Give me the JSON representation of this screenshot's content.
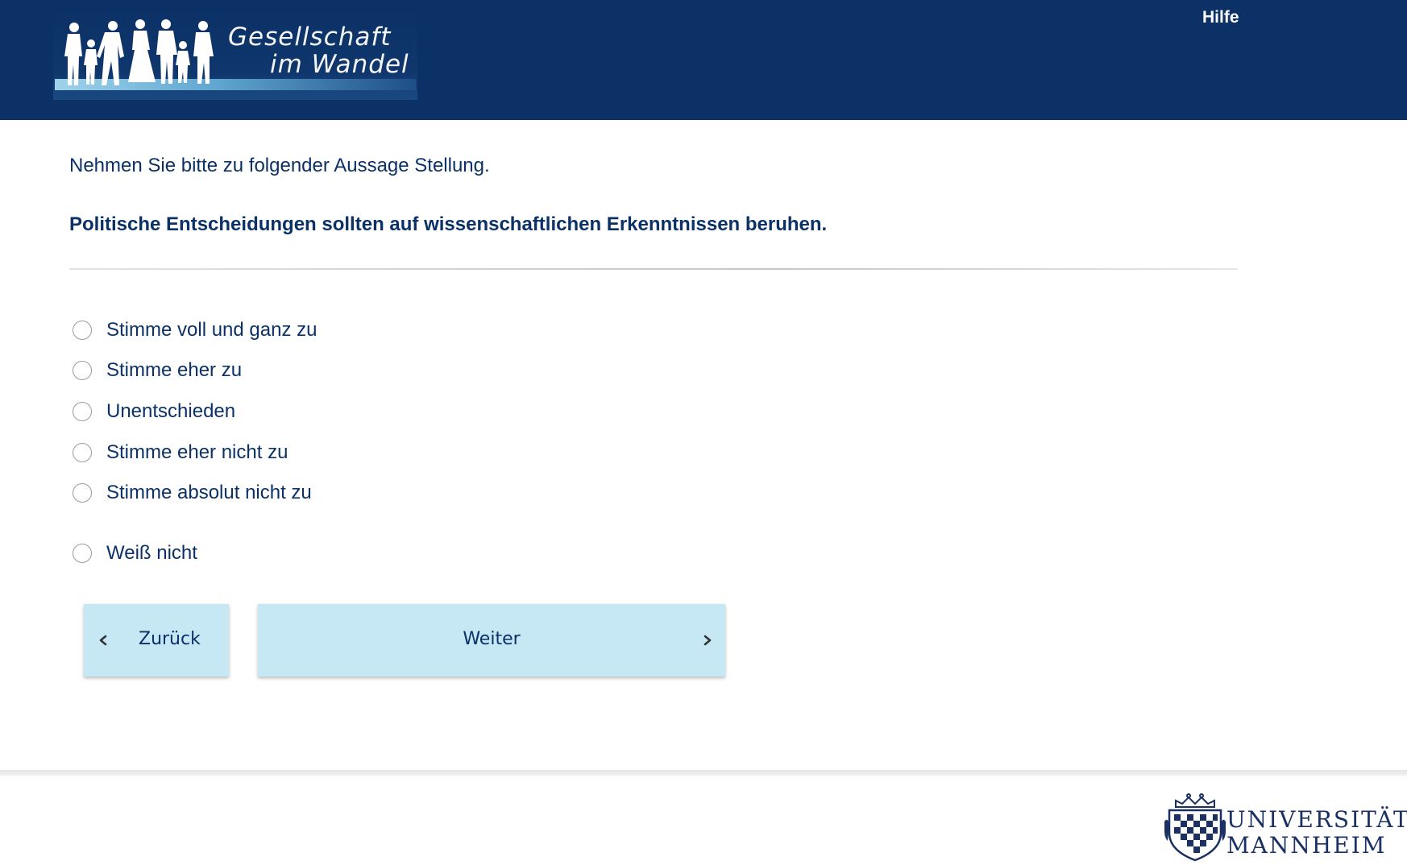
{
  "header": {
    "logo": {
      "line1": "Gesellschaft",
      "line2": "im Wandel"
    },
    "help_label": "Hilfe"
  },
  "question": {
    "intro": "Nehmen Sie bitte zu folgender Aussage Stellung.",
    "statement": "Politische Entscheidungen sollten auf wissenschaftlichen Erkenntnissen beruhen."
  },
  "options": [
    {
      "label": "Stimme voll und ganz zu",
      "selected": false
    },
    {
      "label": "Stimme eher zu",
      "selected": false
    },
    {
      "label": "Unentschieden",
      "selected": false
    },
    {
      "label": "Stimme eher nicht zu",
      "selected": false
    },
    {
      "label": "Stimme absolut nicht zu",
      "selected": false
    },
    {
      "label": "Weiß nicht",
      "selected": false
    }
  ],
  "navigation": {
    "back_label": "Zurück",
    "next_label": "Weiter"
  },
  "footer": {
    "university_line1": "UNIVERSITÄT",
    "university_line2": "MANNHEIM"
  },
  "colors": {
    "header_bg": "#0b3166",
    "text_primary": "#0b3166",
    "button_bg": "#c6e7f4",
    "radio_border": "#9a9a9a"
  }
}
